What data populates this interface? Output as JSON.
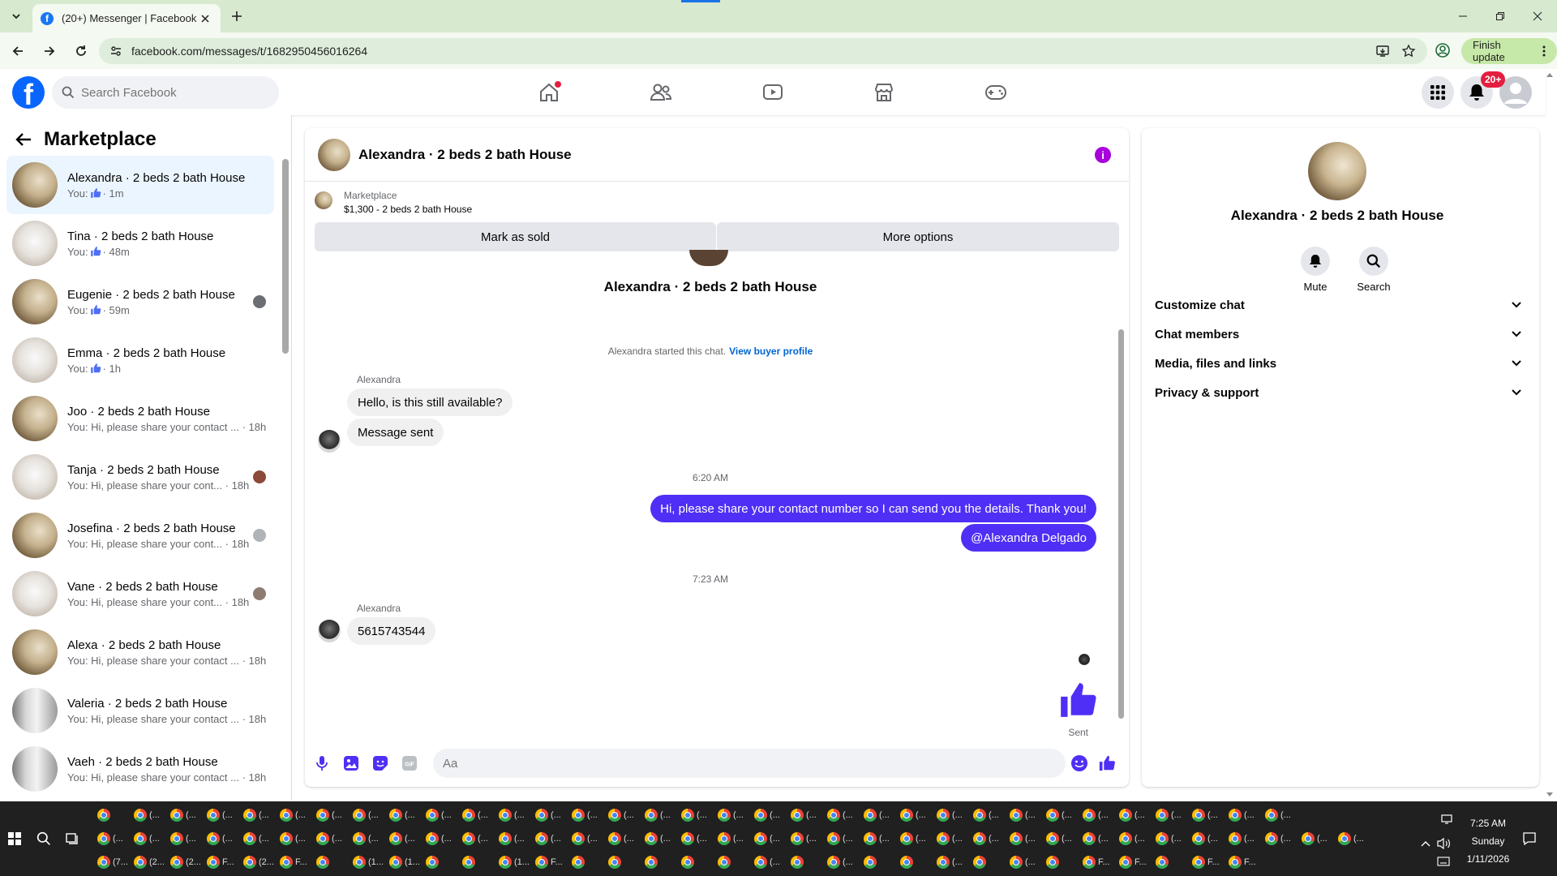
{
  "browser": {
    "tab_title": "(20+) Messenger | Facebook",
    "url": "facebook.com/messages/t/1682950456016264",
    "finish_update_label": "Finish update"
  },
  "fb": {
    "search_placeholder": "Search Facebook",
    "notification_badge": "20+"
  },
  "left": {
    "title": "Marketplace",
    "conversations": [
      {
        "name": "Alexandra · 2 beds 2 bath House",
        "preview": "You:",
        "time": "· 1m",
        "like": true
      },
      {
        "name": "Tina · 2 beds 2 bath House",
        "preview": "You:",
        "time": "· 48m",
        "like": true
      },
      {
        "name": "Eugenie · 2 beds 2 bath House",
        "preview": "You:",
        "time": "· 59m",
        "like": true
      },
      {
        "name": "Emma · 2 beds 2 bath House",
        "preview": "You:",
        "time": "· 1h",
        "like": true
      },
      {
        "name": "Joo · 2 beds 2 bath House",
        "preview": "You: Hi, please share your contact ...",
        "time": "· 18h"
      },
      {
        "name": "Tanja · 2 beds 2 bath House",
        "preview": "You: Hi, please share your cont...",
        "time": "· 18h"
      },
      {
        "name": "Josefina · 2 beds 2 bath House",
        "preview": "You: Hi, please share your cont...",
        "time": "· 18h"
      },
      {
        "name": "Vane · 2 beds 2 bath House",
        "preview": "You: Hi, please share your cont...",
        "time": "· 18h"
      },
      {
        "name": "Alexa · 2 beds 2 bath House",
        "preview": "You: Hi, please share your contact ...",
        "time": "· 18h"
      },
      {
        "name": "Valeria · 2 beds 2 bath House",
        "preview": "You: Hi, please share your contact ...",
        "time": "· 18h"
      },
      {
        "name": "Vaeh · 2 beds 2 bath House",
        "preview": "You: Hi, please share your contact ...",
        "time": "· 18h"
      }
    ]
  },
  "chat": {
    "title": "Alexandra · 2 beds 2 bath House",
    "marketplace_label": "Marketplace",
    "listing": "$1,300 - 2 beds 2 bath House",
    "mark_sold_label": "Mark as sold",
    "more_options_label": "More options",
    "thread_name": "Alexandra · 2 beds 2 bath House",
    "started_text": "Alexandra started this chat.",
    "view_profile_label": "View buyer profile",
    "sender_1": "Alexandra",
    "msg_1": "Hello, is this still available?",
    "msg_2": "Message sent",
    "time_1": "6:20 AM",
    "out_1": "Hi, please share your contact number so I can send you the details. Thank you!",
    "out_2": "@Alexandra Delgado",
    "time_2": "7:23 AM",
    "sender_2": "Alexandra",
    "msg_3": "5615743544",
    "sent_label": "Sent",
    "composer_placeholder": "Aa"
  },
  "right": {
    "name": "Alexandra · 2 beds 2 bath House",
    "mute_label": "Mute",
    "search_label": "Search",
    "sections": [
      "Customize chat",
      "Chat members",
      "Media, files and links",
      "Privacy & support"
    ]
  },
  "taskbar": {
    "time": "7:25 AM",
    "day": "Sunday",
    "date": "1/11/2026",
    "row1_labels": [
      "",
      "(...",
      "(...",
      "(...",
      "(...",
      "(...",
      "(...",
      "(...",
      "(...",
      "(...",
      "(...",
      "(...",
      "(...",
      "(...",
      "(...",
      "(...",
      "(...",
      "(...",
      "(...",
      "(...",
      "(...",
      "(...",
      "(...",
      "(...",
      "(...",
      "(...",
      "(...",
      "(...",
      "(...",
      "(...",
      "(...",
      "(...",
      "(..."
    ],
    "row2_labels": [
      "(...",
      "(...",
      "(...",
      "(...",
      "(...",
      "(...",
      "(...",
      "(...",
      "(...",
      "(...",
      "(...",
      "(...",
      "(...",
      "(...",
      "(...",
      "(...",
      "(...",
      "(...",
      "(...",
      "(...",
      "(...",
      "(...",
      "(...",
      "(...",
      "(...",
      "(...",
      "(...",
      "(...",
      "(...",
      "(...",
      "(...",
      "(...",
      "(...",
      "(...",
      "(..."
    ],
    "row3_labels": [
      "(7...",
      "(2...",
      "(2...",
      "F...",
      "(2...",
      "F...",
      "",
      "(1...",
      "(1...",
      "",
      "",
      "(1...",
      "F...",
      "",
      "",
      "",
      "",
      "",
      "(...",
      "",
      "(...",
      "",
      "",
      "(...",
      "",
      "(...",
      "",
      "F...",
      "F...",
      "",
      "F...",
      "F..."
    ]
  },
  "colors": {
    "accent": "#0866ff",
    "outgoing_bubble": "#4f2ff5",
    "badge": "#e41e3f",
    "info": "#a800dd"
  }
}
